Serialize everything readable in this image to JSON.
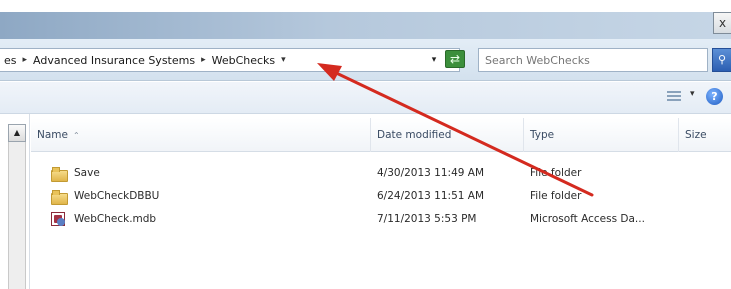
{
  "window": {
    "close_glyph": "x"
  },
  "address": {
    "breadcrumb": [
      "es",
      "Advanced Insurance Systems",
      "WebChecks"
    ],
    "separator_glyph": "▸",
    "dropdown_glyph": "▾"
  },
  "search": {
    "placeholder": "Search WebChecks",
    "button_glyph": "⚲"
  },
  "toolbar": {
    "help_glyph": "?"
  },
  "nav": {
    "scroll_up_glyph": "▲"
  },
  "columns": {
    "name": "Name",
    "date_modified": "Date modified",
    "type": "Type",
    "size": "Size",
    "sort_glyph": "⌃"
  },
  "files": [
    {
      "name": "Save",
      "date": "4/30/2013 11:49 AM",
      "type": "File folder",
      "icon": "folder-icon"
    },
    {
      "name": "WebCheckDBBU",
      "date": "6/24/2013 11:51 AM",
      "type": "File folder",
      "icon": "folder-icon"
    },
    {
      "name": "WebCheck.mdb",
      "date": "7/11/2013 5:53 PM",
      "type": "Microsoft Access Da...",
      "icon": "access-database-icon"
    }
  ],
  "annotation": {
    "arrow_color": "#d42a1f"
  }
}
